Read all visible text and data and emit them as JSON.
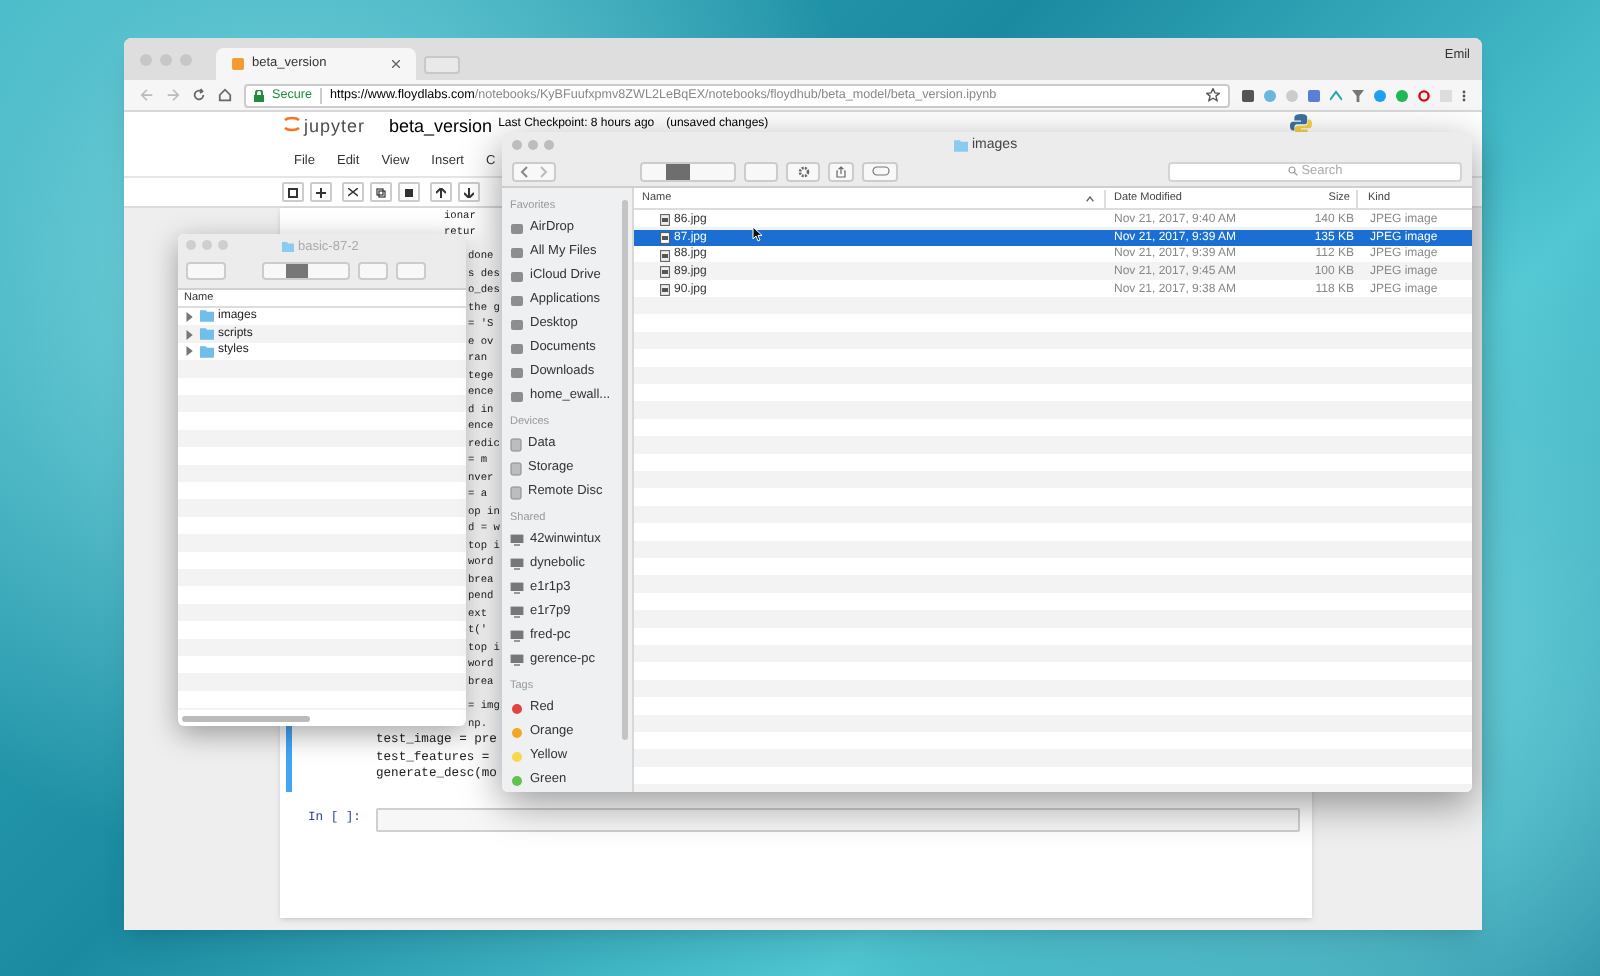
{
  "browser": {
    "tab_title": "beta_version",
    "user": "Emil",
    "secure_label": "Secure",
    "url_host": "https://www.floydlabs.com",
    "url_path": "/notebooks/KyBFuufxpmv8ZWL2LeBqEX/notebooks/floydhub/beta_model/beta_version.ipynb"
  },
  "notebook": {
    "brand": "jupyter",
    "name": "beta_version",
    "checkpoint": "Last Checkpoint: 8 hours ago",
    "unsaved": "(unsaved changes)",
    "menu": [
      "File",
      "Edit",
      "View",
      "Insert",
      "C"
    ],
    "code_top": [
      "ionar",
      "retur"
    ],
    "code_strip": [
      "done",
      "s des",
      "o_des",
      "the g",
      "= 'S",
      "e ov",
      "ran",
      "tege",
      "ence",
      "d in",
      "ence",
      "redic",
      "= m",
      "nver",
      "= a",
      "op in",
      "d = w",
      "top i",
      "word",
      "brea",
      "pend",
      "ext",
      "t('",
      "top i",
      "word",
      "brea"
    ],
    "code_tail_partial": [
      "= img",
      "np."
    ],
    "code_tail": [
      "test_image = pre",
      "test_features =",
      "generate_desc(mo"
    ],
    "prompt": "In [ ]:"
  },
  "small_finder": {
    "title": "basic-87-2",
    "column": "Name",
    "items": [
      {
        "name": "images",
        "expanded": false
      },
      {
        "name": "scripts",
        "expanded": false
      },
      {
        "name": "styles",
        "expanded": false
      }
    ]
  },
  "finder": {
    "title": "images",
    "search_placeholder": "Search",
    "sidebar": [
      {
        "heading": "Favorites",
        "kind": "places",
        "items": [
          {
            "label": "AirDrop"
          },
          {
            "label": "All My Files"
          },
          {
            "label": "iCloud Drive"
          },
          {
            "label": "Applications"
          },
          {
            "label": "Desktop"
          },
          {
            "label": "Documents"
          },
          {
            "label": "Downloads"
          },
          {
            "label": "home_ewall..."
          }
        ]
      },
      {
        "heading": "Devices",
        "kind": "devices",
        "items": [
          {
            "label": "Data"
          },
          {
            "label": "Storage"
          },
          {
            "label": "Remote Disc"
          }
        ]
      },
      {
        "heading": "Shared",
        "kind": "shared",
        "items": [
          {
            "label": "42winwintux"
          },
          {
            "label": "dynebolic"
          },
          {
            "label": "e1r1p3"
          },
          {
            "label": "e1r7p9"
          },
          {
            "label": "fred-pc"
          },
          {
            "label": "gerence-pc"
          }
        ]
      },
      {
        "heading": "Tags",
        "kind": "tags",
        "items": [
          {
            "label": "Red",
            "color": "#e0443e"
          },
          {
            "label": "Orange",
            "color": "#f5a623"
          },
          {
            "label": "Yellow",
            "color": "#f8d64e"
          },
          {
            "label": "Green",
            "color": "#5fc44b"
          }
        ]
      }
    ],
    "columns": [
      "Name",
      "Date Modified",
      "Size",
      "Kind"
    ],
    "rows": [
      {
        "name": "86.jpg",
        "date": "Nov 21, 2017, 9:40 AM",
        "size": "140 KB",
        "kind": "JPEG image",
        "selected": false
      },
      {
        "name": "87.jpg",
        "date": "Nov 21, 2017, 9:39 AM",
        "size": "135 KB",
        "kind": "JPEG image",
        "selected": true
      },
      {
        "name": "88.jpg",
        "date": "Nov 21, 2017, 9:39 AM",
        "size": "112 KB",
        "kind": "JPEG image",
        "selected": false
      },
      {
        "name": "89.jpg",
        "date": "Nov 21, 2017, 9:45 AM",
        "size": "100 KB",
        "kind": "JPEG image",
        "selected": false
      },
      {
        "name": "90.jpg",
        "date": "Nov 21, 2017, 9:38 AM",
        "size": "118 KB",
        "kind": "JPEG image",
        "selected": false
      }
    ]
  }
}
